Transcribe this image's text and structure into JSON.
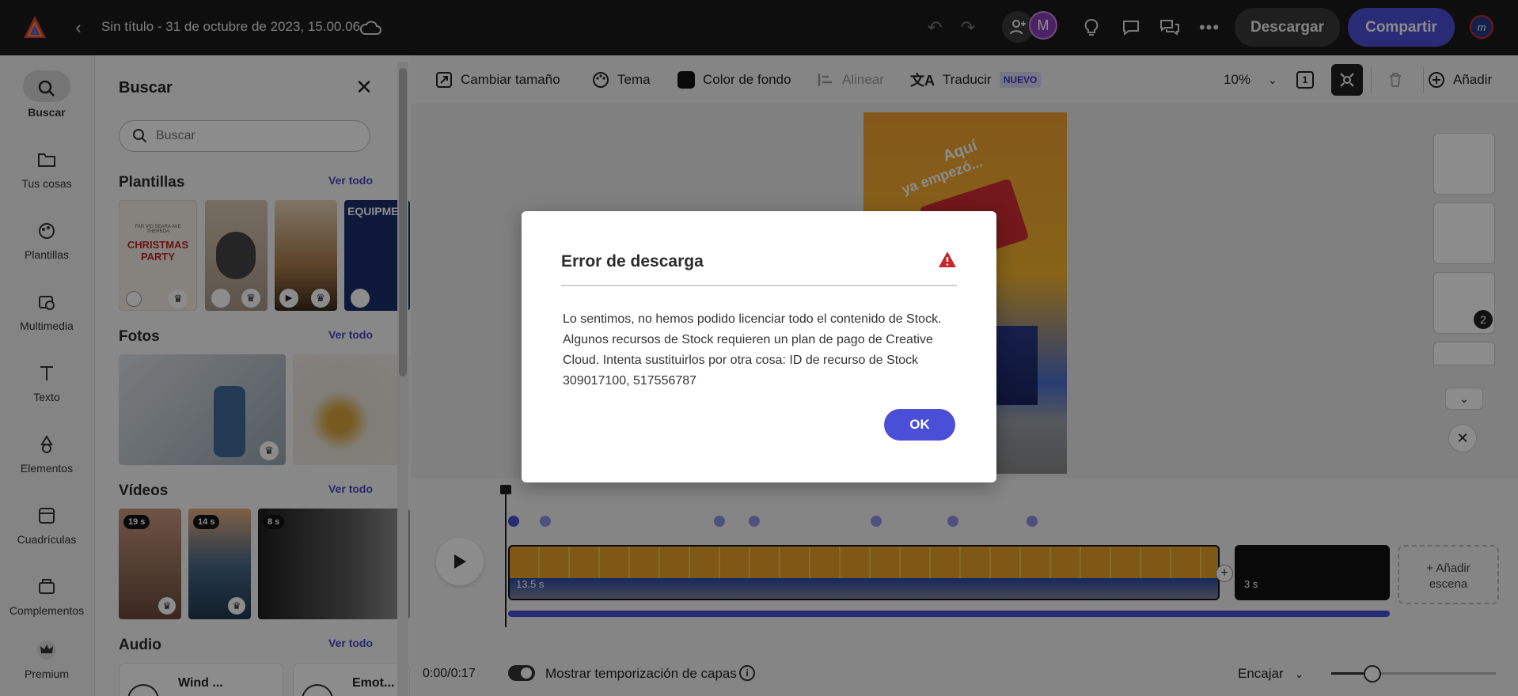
{
  "topbar": {
    "doc_title": "Sin título - 31 de octubre de 2023, 15.00.06",
    "avatar_initial": "M",
    "download_label": "Descargar",
    "share_label": "Compartir",
    "brand_avatar": "m"
  },
  "rail": {
    "items": [
      {
        "label": "Buscar",
        "icon": "search-icon"
      },
      {
        "label": "Tus cosas",
        "icon": "folder-icon"
      },
      {
        "label": "Plantillas",
        "icon": "templates-icon"
      },
      {
        "label": "Multimedia",
        "icon": "media-icon"
      },
      {
        "label": "Texto",
        "icon": "text-icon"
      },
      {
        "label": "Elementos",
        "icon": "shapes-icon"
      },
      {
        "label": "Cuadrículas",
        "icon": "grid-icon"
      },
      {
        "label": "Complementos",
        "icon": "addons-icon"
      },
      {
        "label": "Premium",
        "icon": "crown-icon"
      }
    ]
  },
  "panel": {
    "title": "Buscar",
    "search_placeholder": "Buscar",
    "templates": {
      "title": "Plantillas",
      "see_all": "Ver todo",
      "t1_lines": [
        "FAR VID SEARA AVE",
        "THEREDA",
        "CHRISTMAS",
        "PARTY"
      ],
      "t4_text": "EQUIPMEN"
    },
    "photos": {
      "title": "Fotos",
      "see_all": "Ver todo"
    },
    "videos": {
      "title": "Vídeos",
      "see_all": "Ver todo",
      "durations": [
        "19 s",
        "14 s",
        "8 s"
      ]
    },
    "audio": {
      "title": "Audio",
      "see_all": "Ver todo",
      "tracks": [
        "Wind ...",
        "Emot..."
      ]
    }
  },
  "toolbar": {
    "resize": "Cambiar tamaño",
    "theme": "Tema",
    "bg_color": "Color de fondo",
    "align": "Alinear",
    "translate": "Traducir",
    "new_badge": "NUEVO",
    "zoom": "10%",
    "page_count": "1",
    "add": "Añadir"
  },
  "canvas": {
    "poster_text1": "Aquí",
    "poster_text2": "ya empezó...",
    "scene_badge": "2"
  },
  "timeline": {
    "clip1_duration": "13.5 s",
    "clip2_duration": "3 s",
    "add_scene": "+ Añadir escena",
    "time": "0:00/0:17",
    "layer_timing": "Mostrar temporización de capas",
    "fit": "Encajar"
  },
  "dialog": {
    "title": "Error de descarga",
    "body": "Lo sentimos, no hemos podido licenciar todo el contenido de Stock. Algunos recursos de Stock requieren un plan de pago de Creative Cloud. Intenta sustituirlos por otra cosa: ID de recurso de Stock 309017100, 517556787",
    "ok": "OK"
  },
  "colors": {
    "accent": "#4b4fd8",
    "warning": "#c9252c",
    "topbar": "#1b1b1b"
  }
}
